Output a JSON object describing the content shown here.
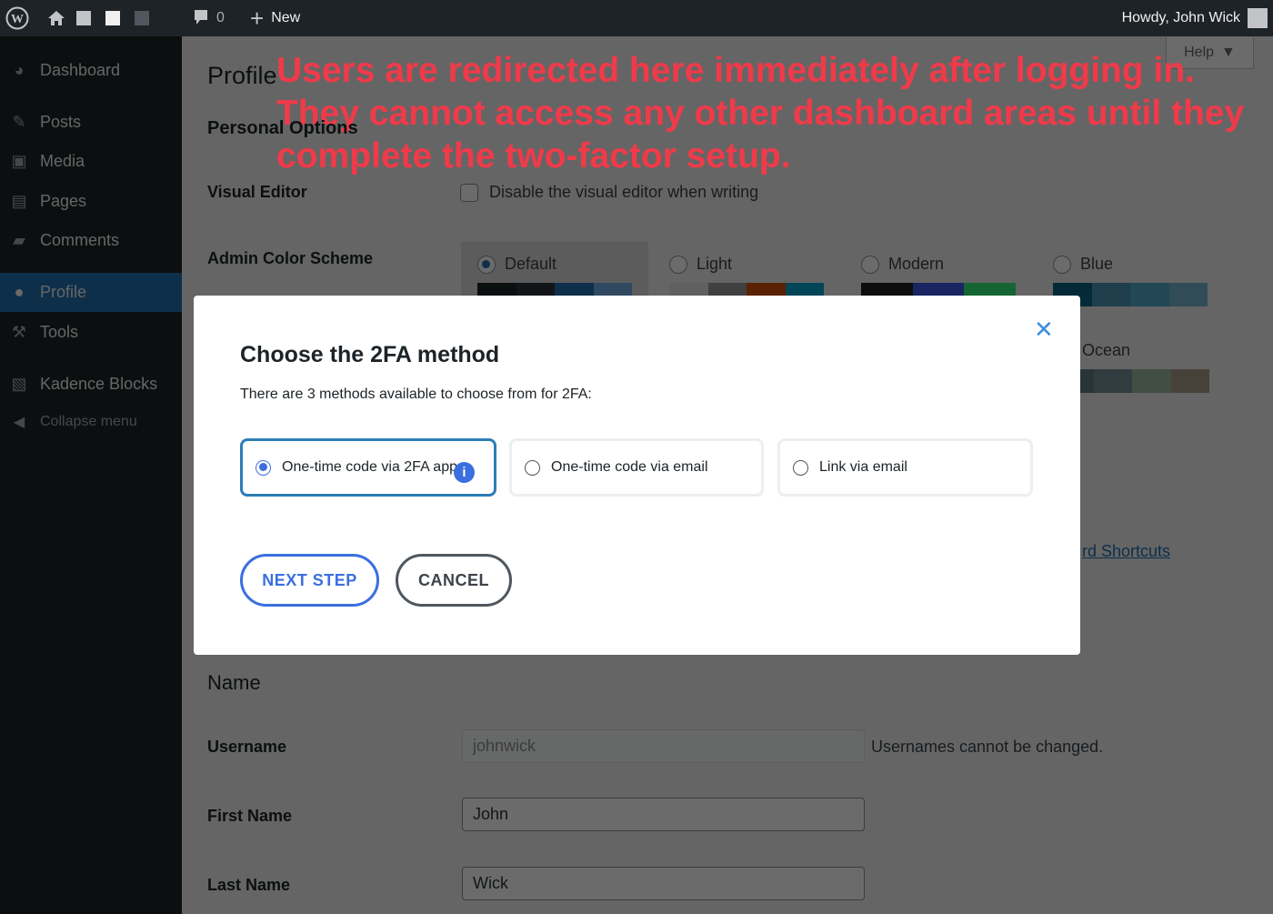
{
  "adminbar": {
    "comments_count": "0",
    "new_label": "New",
    "howdy": "Howdy, John Wick"
  },
  "sidebar": {
    "items": [
      {
        "label": "Dashboard",
        "icon": "dashboard-icon"
      },
      {
        "label": "Posts",
        "icon": "pin-icon"
      },
      {
        "label": "Media",
        "icon": "media-icon"
      },
      {
        "label": "Pages",
        "icon": "pages-icon"
      },
      {
        "label": "Comments",
        "icon": "comment-icon"
      },
      {
        "label": "Profile",
        "icon": "user-icon",
        "active": true
      },
      {
        "label": "Tools",
        "icon": "wrench-icon"
      },
      {
        "label": "Kadence Blocks",
        "icon": "kadence-icon"
      },
      {
        "label": "Collapse menu",
        "icon": "collapse-icon"
      }
    ]
  },
  "page": {
    "title": "Profile",
    "help": "Help",
    "personal_options": "Personal Options",
    "visual_editor_label": "Visual Editor",
    "visual_editor_checkbox": "Disable the visual editor when writing",
    "color_scheme_label": "Admin Color Scheme",
    "schemes": [
      {
        "name": "Default",
        "selected": true,
        "colors": [
          "#1d2327",
          "#2c3338",
          "#2271b1",
          "#72aee6"
        ]
      },
      {
        "name": "Light",
        "colors": [
          "#e5e5e5",
          "#999999",
          "#d64e07",
          "#04a4cc"
        ]
      },
      {
        "name": "Modern",
        "colors": [
          "#1e1e1e",
          "#3858e9",
          "#33f078"
        ]
      },
      {
        "name": "Blue",
        "colors": [
          "#096484",
          "#4796b3",
          "#52accc",
          "#74b6ce"
        ]
      },
      {
        "name": "Ocean",
        "colors": [
          "#627c83",
          "#738e96",
          "#9ebaa0",
          "#aa9d88"
        ]
      }
    ],
    "shortcuts_link": "rd Shortcuts",
    "name_heading": "Name",
    "username_label": "Username",
    "username_value": "johnwick",
    "username_note": "Usernames cannot be changed.",
    "first_name_label": "First Name",
    "first_name_value": "John",
    "last_name_label": "Last Name",
    "last_name_value": "Wick"
  },
  "modal": {
    "title": "Choose the 2FA method",
    "subtitle": "There are 3 methods available to choose from for 2FA:",
    "options": [
      "One-time code via 2FA app",
      "One-time code via email",
      "Link via email"
    ],
    "next": "NEXT STEP",
    "cancel": "CANCEL",
    "accent": "#3b6fe0"
  },
  "annotation": "Users are redirected here immediately after logging in. They cannot access any other dashboard areas until they complete the two-factor setup."
}
